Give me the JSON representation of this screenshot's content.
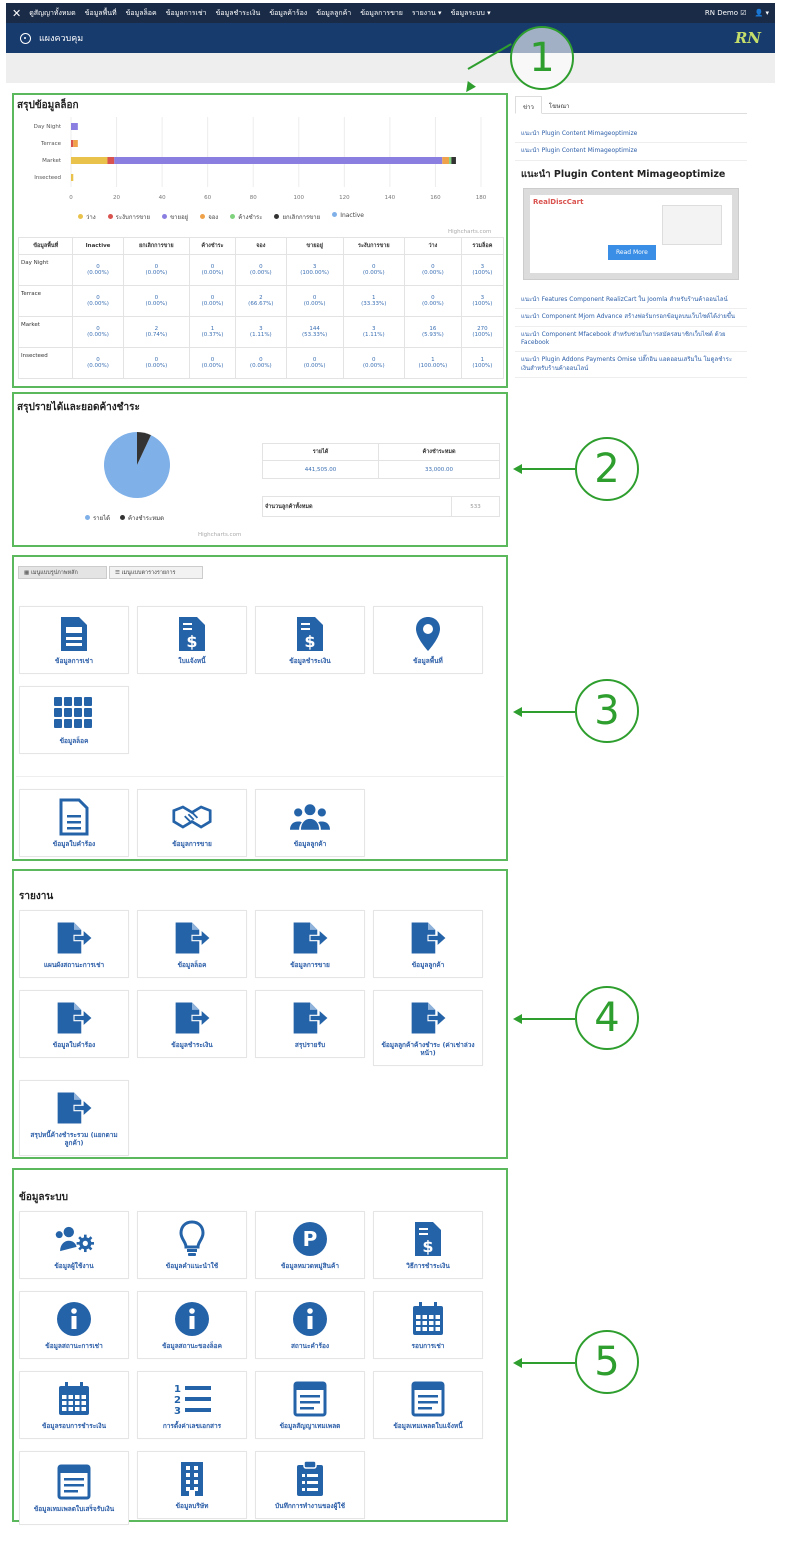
{
  "topbar": {
    "logo": "✕",
    "items": [
      "ดูสัญญาทั้งหมด",
      "ข้อมูลพื้นที่",
      "ข้อมูลล็อค",
      "ข้อมูลการเช่า",
      "ข้อมูลชำระเงิน",
      "ข้อมูลค้าร้อง",
      "ข้อมูลลูกค้า",
      "ข้อมูลการขาย",
      "รายงาน ▾",
      "ข้อมูลระบบ ▾"
    ],
    "user": "RN Demo ☑",
    "user_menu": "👤 ▾"
  },
  "subbar": {
    "title": "แผงควบคุม",
    "brand": "RN"
  },
  "panel1": {
    "title": "สรุปข้อมูลล็อก",
    "chart_data": {
      "type": "bar",
      "orientation": "horizontal",
      "stacked": true,
      "categories": [
        "Day Night",
        "Terrace",
        "Market",
        "Insecteed"
      ],
      "x_ticks": [
        "0",
        "20",
        "40",
        "60",
        "80",
        "100",
        "120",
        "140",
        "160",
        "180"
      ],
      "xlim": [
        0,
        180
      ],
      "legend_position": "bottom",
      "series": [
        {
          "name": "ว่าง",
          "color": "#e8c24a",
          "values": [
            0,
            0,
            16,
            1
          ]
        },
        {
          "name": "ระงับการขาย",
          "color": "#d9534f",
          "values": [
            0,
            1,
            3,
            0
          ]
        },
        {
          "name": "ขายอยู่",
          "color": "#8a7fe0",
          "values": [
            3,
            0,
            144,
            0
          ]
        },
        {
          "name": "จอง",
          "color": "#f0a24a",
          "values": [
            0,
            2,
            3,
            0
          ]
        },
        {
          "name": "ค้างชำระ",
          "color": "#7fd37f",
          "values": [
            0,
            0,
            1,
            0
          ]
        },
        {
          "name": "ยกเลิกการขาย",
          "color": "#333333",
          "values": [
            0,
            0,
            2,
            0
          ]
        },
        {
          "name": "Inactive",
          "color": "#7fb0e8",
          "values": [
            0,
            0,
            0,
            0
          ]
        }
      ],
      "credit": "Highcharts.com"
    },
    "table": {
      "headers": [
        "ข้อมูลพื้นที่",
        "Inactive",
        "ยกเลิกการขาย",
        "ค้างชำระ",
        "จอง",
        "ขายอยู่",
        "ระงับการขาย",
        "ว่าง",
        "รวมล็อค"
      ],
      "rows": [
        [
          "Day Night",
          "0\n(0.00%)",
          "0\n(0.00%)",
          "0\n(0.00%)",
          "0\n(0.00%)",
          "3\n(100.00%)",
          "0\n(0.00%)",
          "0\n(0.00%)",
          "3\n(100%)"
        ],
        [
          "Terrace",
          "0\n(0.00%)",
          "0\n(0.00%)",
          "0\n(0.00%)",
          "2\n(66.67%)",
          "0\n(0.00%)",
          "1\n(33.33%)",
          "0\n(0.00%)",
          "3\n(100%)"
        ],
        [
          "Market",
          "0\n(0.00%)",
          "2\n(0.74%)",
          "1\n(0.37%)",
          "3\n(1.11%)",
          "144\n(53.33%)",
          "3\n(1.11%)",
          "16\n(5.93%)",
          "270\n(100%)"
        ],
        [
          "Insecteed",
          "0\n(0.00%)",
          "0\n(0.00%)",
          "0\n(0.00%)",
          "0\n(0.00%)",
          "0\n(0.00%)",
          "0\n(0.00%)",
          "1\n(100.00%)",
          "1\n(100%)"
        ]
      ]
    }
  },
  "panel2": {
    "title": "สรุปรายได้และยอดค้างชำระ",
    "chart_data": {
      "type": "pie",
      "slices": [
        {
          "name": "รายได้",
          "value": 441505,
          "color": "#7fb0e8"
        },
        {
          "name": "ค้างชำระหมด",
          "value": 33000,
          "color": "#333333"
        }
      ],
      "legend_position": "bottom",
      "credit": "Highcharts.com"
    },
    "summary": {
      "col1_header": "รายได้",
      "col2_header": "ค้างชำระหมด",
      "col1_value": "441,505.00",
      "col2_value": "33,000.00",
      "count_label": "จำนวนลูกค้าทั้งหมด",
      "count_value": "533"
    }
  },
  "panel3": {
    "tabs": [
      "▦ เมนูแบบรูปภาพหลัก",
      "☰ เมนูแบบตารางรายการ"
    ],
    "tiles": [
      {
        "label": "ข้อมูลการเช่า",
        "icon": "document-list-icon"
      },
      {
        "label": "ใบแจ้งหนี้",
        "icon": "invoice-dollar-icon"
      },
      {
        "label": "ข้อมูลชำระเงิน",
        "icon": "payment-dollar-icon"
      },
      {
        "label": "ข้อมูลพื้นที่",
        "icon": "map-marker-icon"
      },
      {
        "label": "ข้อมูลล็อค",
        "icon": "grid-icon"
      },
      {
        "label": "ข้อมูลใบคำร้อง",
        "icon": "file-text-icon"
      },
      {
        "label": "ข้อมูลการขาย",
        "icon": "handshake-icon"
      },
      {
        "label": "ข้อมูลลูกค้า",
        "icon": "users-icon"
      }
    ]
  },
  "panel4": {
    "title": "รายงาน",
    "tiles": [
      "แผนผังสถานะการเช่า",
      "ข้อมูลล็อค",
      "ข้อมูลการขาย",
      "ข้อมูลลูกค้า",
      "ข้อมูลใบคำร้อง",
      "ข้อมูลชำระเงิน",
      "สรุปรายรับ",
      "ข้อมูลลูกค้าค้างชำระ (ค่าเช่าล่วงหน้า)",
      "สรุปหนี้ค้างชำระรวม (แยกตามลูกค้า)"
    ]
  },
  "panel5": {
    "title": "ข้อมูลระบบ",
    "tiles": [
      {
        "label": "ข้อมูลผู้ใช้งาน",
        "icon": "users-gear-icon"
      },
      {
        "label": "ข้อมูลคำแนะนำใช้",
        "icon": "lightbulb-icon"
      },
      {
        "label": "ข้อมูลหมวดหมู่สินค้า",
        "icon": "parking-icon"
      },
      {
        "label": "วิธีการชำระเงิน",
        "icon": "invoice-dollar-icon"
      },
      {
        "label": "ข้อมูลสถานะการเช่า",
        "icon": "info-icon"
      },
      {
        "label": "ข้อมูลสถานะของล็อค",
        "icon": "info-icon"
      },
      {
        "label": "สถานะคำร้อง",
        "icon": "info-icon"
      },
      {
        "label": "รอบการเช่า",
        "icon": "calendar-icon"
      },
      {
        "label": "ข้อมูลรอบการชำระเงิน",
        "icon": "calendar-icon"
      },
      {
        "label": "การตั้งค่าเลขเอกสาร",
        "icon": "ordered-list-icon"
      },
      {
        "label": "ข้อมูลสัญญาเทมเพลต",
        "icon": "template-icon"
      },
      {
        "label": "ข้อมูลเทมเพลตใบแจ้งหนี้",
        "icon": "template-icon"
      },
      {
        "label": "ข้อมูลเทมเพลตใบเสร็จรับเงิน",
        "icon": "template-icon"
      },
      {
        "label": "ข้อมูลบริษัท",
        "icon": "building-icon"
      },
      {
        "label": "บันทึกการทำงานของผู้ใช้",
        "icon": "clipboard-icon"
      }
    ]
  },
  "sidebar": {
    "tabs": [
      "ข่าว",
      "โฆษณา"
    ],
    "links_top": [
      "แนะนำ Plugin Content Mimageoptimize",
      "แนะนำ Plugin Content Mimageoptimize"
    ],
    "headline": "แนะนำ Plugin Content Mimageoptimize",
    "promo_button": "Read More",
    "promo_brand": "RealDiscCart",
    "links_bottom": [
      "แนะนำ Features Component RealizCart ใน Joomla สำหรับร้านค้าออนไลน์",
      "แนะนำ Component Mjom Advance สร้างฟอร์มกรอกข้อมูลบนเว็บไซต์ได้ง่ายขึ้น",
      "แนะนำ Component Mfacebook สำหรับช่วยในการสมัครสมาชิกเว็บไซต์ ด้วย Facebook",
      "แนะนำ Plugin Addons Payments Omise ปลั๊กอิน แอดออนเสริมใน โมดูลชำระเงินสำหรับร้านค้าออนไลน์"
    ]
  },
  "callouts": [
    "1",
    "2",
    "3",
    "4",
    "5"
  ],
  "colors": {
    "accent": "#2c5ea8",
    "panel_border": "#5cb85c",
    "navbar": "#1a2b47"
  }
}
